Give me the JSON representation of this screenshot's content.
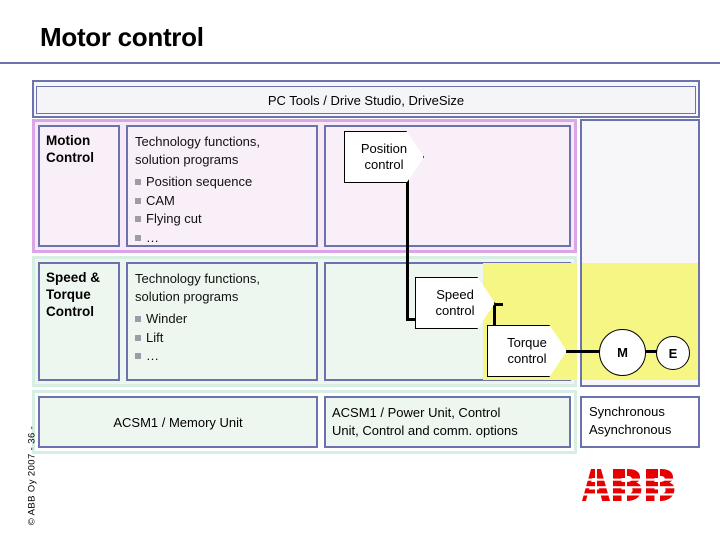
{
  "slide": {
    "title": "Motor control",
    "copyright": "© ABB Oy 2007 - 36 -",
    "logo_alt": "ABB",
    "accent_border": "#6b72ad",
    "violet_row": "#dba6e8",
    "mint_row": "#d7efe2",
    "yellow_band": "#f6f684",
    "logo_color": "#e60000"
  },
  "pctools": {
    "label": "PC Tools / Drive Studio, DriveSize"
  },
  "rows": [
    {
      "id": "motion",
      "label_line1": "Motion",
      "label_line2": "Control",
      "functions_title_line1": "Technology functions,",
      "functions_title_line2": "solution programs",
      "bullets": [
        "Position sequence",
        "CAM",
        "Flying cut",
        "…"
      ]
    },
    {
      "id": "speed-torque",
      "label_line1": "Speed &",
      "label_line2": "Torque",
      "label_line3": "Control",
      "functions_title_line1": "Technology functions,",
      "functions_title_line2": "solution programs",
      "bullets": [
        "Winder",
        "Lift",
        "…"
      ]
    }
  ],
  "callouts": [
    {
      "id": "position",
      "line1": "Position",
      "line2": "control"
    },
    {
      "id": "speed",
      "line1": "Speed",
      "line2": "control"
    },
    {
      "id": "torque",
      "line1": "Torque",
      "line2": "control"
    }
  ],
  "motor": {
    "motor_label": "M",
    "encoder_label": "E"
  },
  "bottom": {
    "left": "ACSM1 / Memory Unit",
    "mid_line1": "ACSM1 / Power Unit, Control",
    "mid_line2": "Unit, Control and comm. options",
    "right_line1": "Synchronous",
    "right_line2": "Asynchronous"
  }
}
